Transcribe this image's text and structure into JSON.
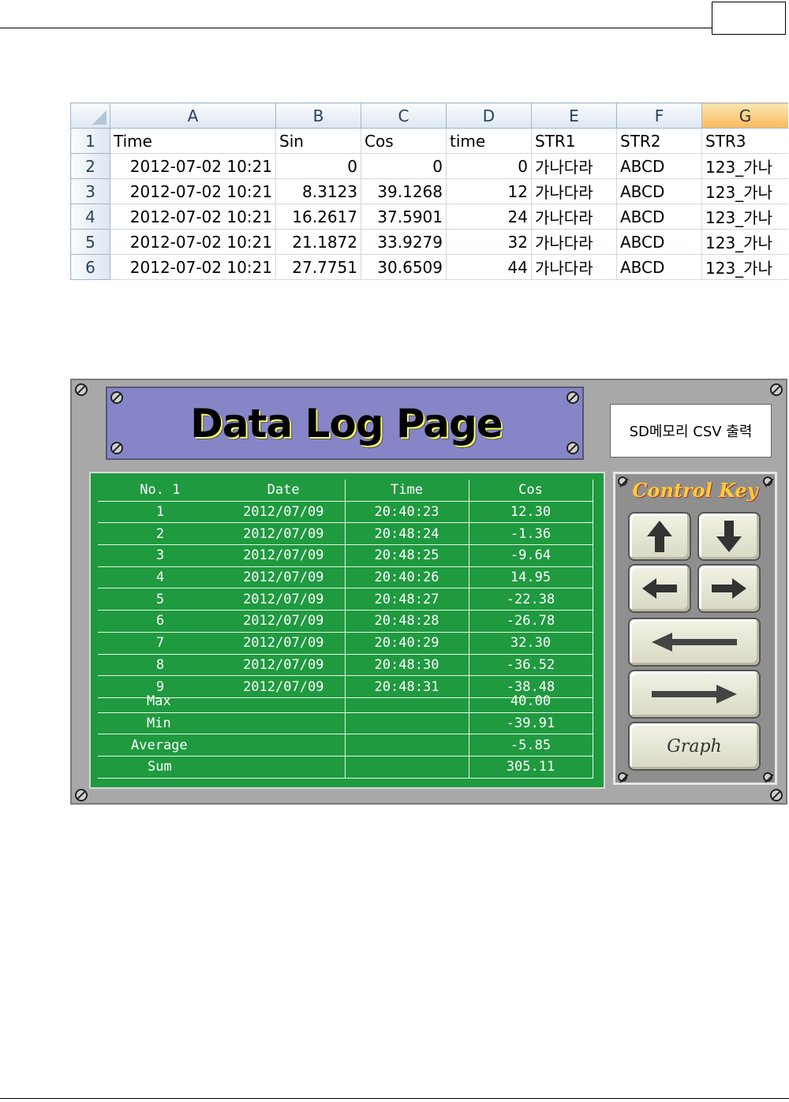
{
  "spreadsheet": {
    "columns": [
      "A",
      "B",
      "C",
      "D",
      "E",
      "F",
      "G"
    ],
    "row_numbers": [
      "1",
      "2",
      "3",
      "4",
      "5",
      "6"
    ],
    "header_row": [
      "Time",
      "Sin",
      "Cos",
      "time",
      "STR1",
      "STR2",
      "STR3"
    ],
    "rows": [
      [
        "2012-07-02 10:21",
        "0",
        "0",
        "0",
        "가나다라",
        "ABCD",
        "123_가나"
      ],
      [
        "2012-07-02 10:21",
        "8.3123",
        "39.1268",
        "12",
        "가나다라",
        "ABCD",
        "123_가나"
      ],
      [
        "2012-07-02 10:21",
        "16.2617",
        "37.5901",
        "24",
        "가나다라",
        "ABCD",
        "123_가나"
      ],
      [
        "2012-07-02 10:21",
        "21.1872",
        "33.9279",
        "32",
        "가나다라",
        "ABCD",
        "123_가나"
      ],
      [
        "2012-07-02 10:21",
        "27.7751",
        "30.6509",
        "44",
        "가나다라",
        "ABCD",
        "123_가나"
      ]
    ],
    "selected_column": "G"
  },
  "hmi": {
    "title": "Data Log Page",
    "csv_button_label": "SD메모리 CSV 출력",
    "log_header": [
      "No. 1",
      "Date",
      "Time",
      "Cos"
    ],
    "log_rows": [
      [
        "1",
        "2012/07/09",
        "20:40:23",
        "12.30"
      ],
      [
        "2",
        "2012/07/09",
        "20:48:24",
        "-1.36"
      ],
      [
        "3",
        "2012/07/09",
        "20:48:25",
        "-9.64"
      ],
      [
        "4",
        "2012/07/09",
        "20:40:26",
        "14.95"
      ],
      [
        "5",
        "2012/07/09",
        "20:48:27",
        "-22.38"
      ],
      [
        "6",
        "2012/07/09",
        "20:48:28",
        "-26.78"
      ],
      [
        "7",
        "2012/07/09",
        "20:40:29",
        "32.30"
      ],
      [
        "8",
        "2012/07/09",
        "20:48:30",
        "-36.52"
      ],
      [
        "9",
        "2012/07/09",
        "20:48:31",
        "-38.48"
      ]
    ],
    "summary_rows": [
      [
        "Max",
        "",
        "40.00"
      ],
      [
        "Min",
        "",
        "-39.91"
      ],
      [
        "Average",
        "",
        "-5.85"
      ],
      [
        "Sum",
        "",
        "305.11"
      ]
    ],
    "keypad": {
      "title": "Control Key",
      "graph_label": "Graph",
      "icons": [
        "arrow-up-icon",
        "arrow-down-icon",
        "arrow-left-icon",
        "arrow-right-icon",
        "long-arrow-left-icon",
        "long-arrow-right-icon"
      ]
    }
  }
}
